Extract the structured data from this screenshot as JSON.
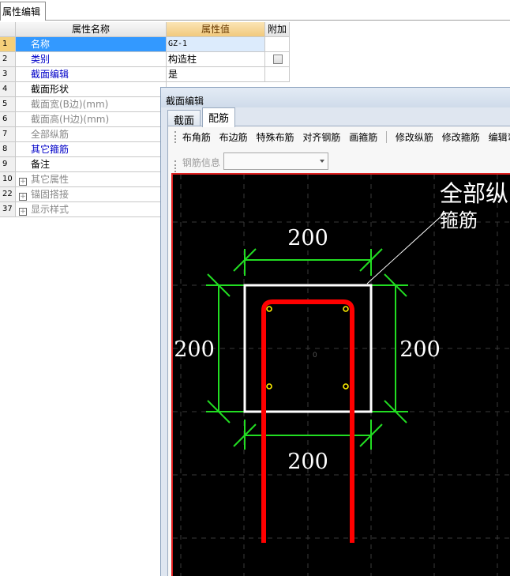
{
  "top_tab": {
    "label": "属性编辑"
  },
  "property_grid": {
    "headers": {
      "name": "属性名称",
      "value": "属性值",
      "extra": "附加"
    },
    "rows": [
      {
        "num": "1",
        "name": "名称",
        "value": "GZ-1"
      },
      {
        "num": "2",
        "name": "类别",
        "value": "构造柱"
      },
      {
        "num": "3",
        "name": "截面编辑",
        "value": "是"
      },
      {
        "num": "4",
        "name": "截面形状",
        "value": ""
      },
      {
        "num": "5",
        "name": "截面宽(B边)(mm)",
        "value": ""
      },
      {
        "num": "6",
        "name": "截面高(H边)(mm)",
        "value": ""
      },
      {
        "num": "7",
        "name": "全部纵筋",
        "value": ""
      },
      {
        "num": "8",
        "name": "其它箍筋",
        "value": ""
      },
      {
        "num": "9",
        "name": "备注",
        "value": ""
      },
      {
        "num": "10",
        "name": "其它属性",
        "value": ""
      },
      {
        "num": "22",
        "name": "锚固搭接",
        "value": ""
      },
      {
        "num": "37",
        "name": "显示样式",
        "value": ""
      }
    ],
    "expander_symbol": "+"
  },
  "dialog": {
    "title": "截面编辑",
    "tabs": [
      "截面",
      "配筋"
    ],
    "active_tab": "配筋",
    "toolbar": [
      "布角筋",
      "布边筋",
      "特殊布筋",
      "对齐钢筋",
      "画箍筋",
      "修改纵筋",
      "修改箍筋",
      "编辑弯钩"
    ],
    "rebar_info_label": "钢筋信息",
    "rebar_info_value": ""
  },
  "drawing": {
    "dim_top": "200",
    "dim_bottom": "200",
    "dim_left": "200",
    "dim_right": "200",
    "callout_line1": "全部纵",
    "callout_line2": "箍筋",
    "center_mark": "0",
    "colors": {
      "background": "#000000",
      "dimension": "#22dd22",
      "section": "#ffffff",
      "stirrup": "#ff0000",
      "rebar": "#ffee00"
    }
  }
}
